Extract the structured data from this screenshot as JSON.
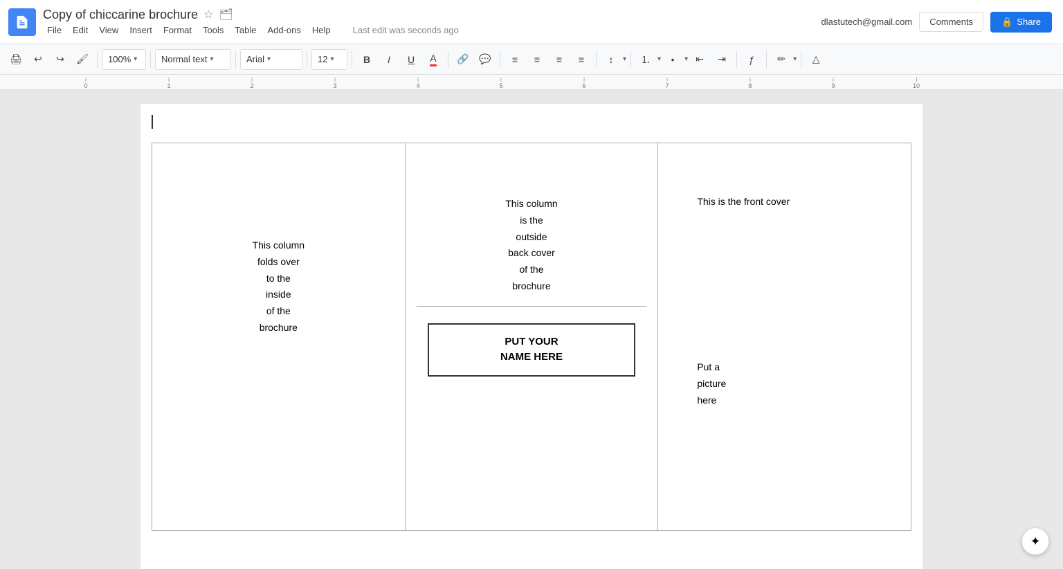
{
  "header": {
    "title": "Copy of chiccarine brochure",
    "user_email": "dlastutech@gmail.com",
    "last_edit": "Last edit was seconds ago",
    "comments_label": "Comments",
    "share_label": "Share"
  },
  "menu": {
    "items": [
      "File",
      "Edit",
      "View",
      "Insert",
      "Format",
      "Tools",
      "Table",
      "Add-ons",
      "Help"
    ]
  },
  "toolbar": {
    "zoom": "100%",
    "style": "Normal text",
    "font": "Arial",
    "size": "12",
    "bold_label": "B",
    "italic_label": "I",
    "underline_label": "U"
  },
  "document": {
    "col1_text": "This column\nfolds over\nto the\ninside\nof the\nbrochure",
    "col2_top_text": "This column\nis the\noutside\nback cover\nof the\nbrochure",
    "col2_name_text": "PUT YOUR\nNAME HERE",
    "col3_title": "This is the front cover",
    "col3_picture": "Put a\npicture\nhere"
  }
}
